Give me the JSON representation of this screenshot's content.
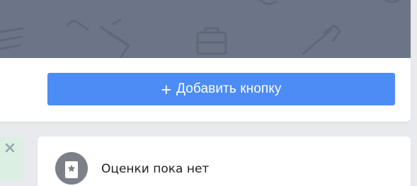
{
  "profile_card": {
    "add_button": {
      "icon": "plus-icon",
      "label": "Добавить кнопку"
    }
  },
  "reviews_card": {
    "icon": "star-badge-icon",
    "text": "Оценки пока нет"
  },
  "side_card": {
    "close_icon": "close-icon"
  },
  "colors": {
    "cover": "#6c7487",
    "button": "#4c8cf5",
    "page_bg": "#e9eaee",
    "side_card_bg": "#dcefe3"
  }
}
